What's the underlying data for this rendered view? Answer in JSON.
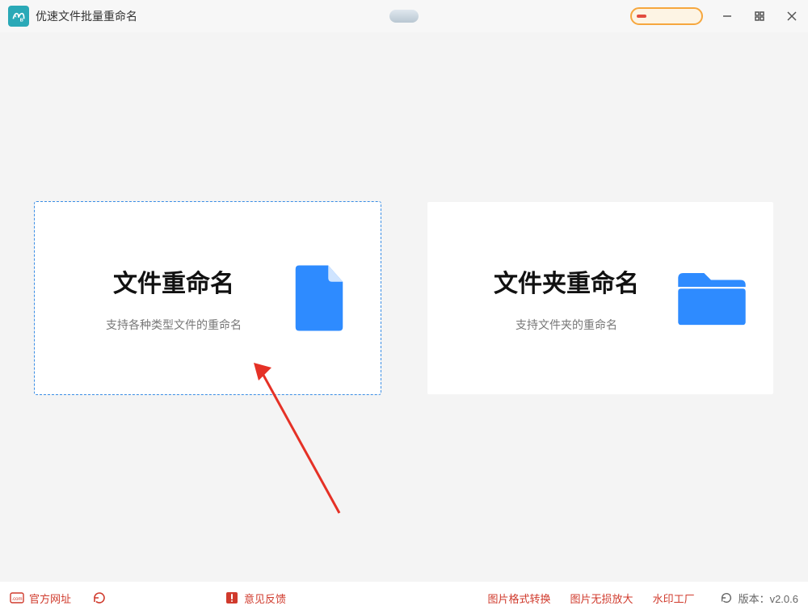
{
  "titlebar": {
    "app_title": "优速文件批量重命名",
    "logo_text": "A/B"
  },
  "cards": {
    "file": {
      "title": "文件重命名",
      "subtitle": "支持各种类型文件的重命名"
    },
    "folder": {
      "title": "文件夹重命名",
      "subtitle": "支持文件夹的重命名"
    }
  },
  "footer": {
    "official": "官方网址",
    "feedback": "意见反馈",
    "link_convert": "图片格式转换",
    "link_upscale": "图片无损放大",
    "link_watermark": "水印工厂",
    "version_label": "版本：v2.0.6"
  }
}
